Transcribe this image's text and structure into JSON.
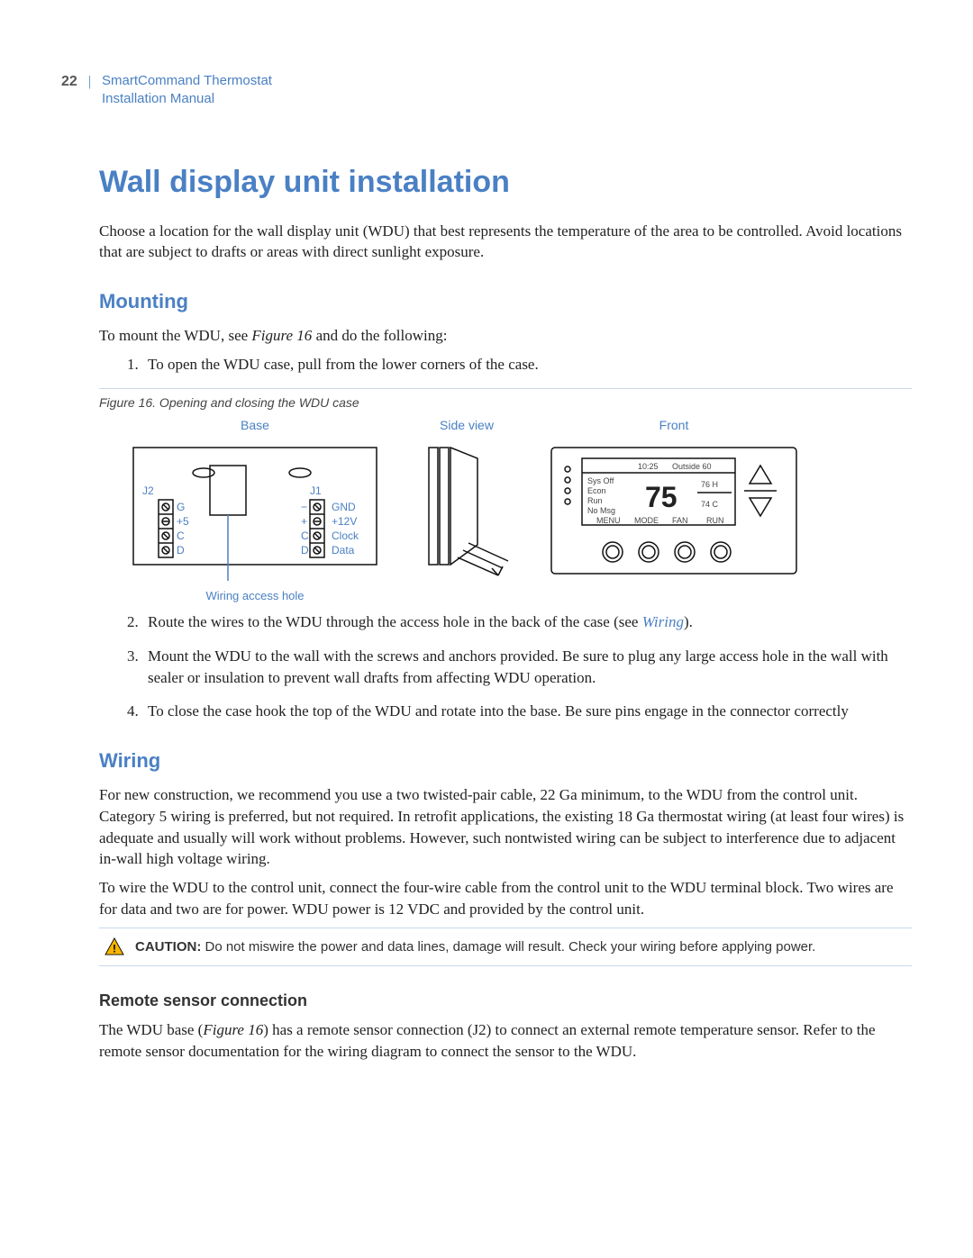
{
  "header": {
    "page_number": "22",
    "doc_title_line1": "SmartCommand Thermostat",
    "doc_title_line2": "Installation Manual"
  },
  "title": "Wall display unit installation",
  "intro": "Choose a location for the wall display unit (WDU) that best represents the temperature of the area to be controlled. Avoid locations that are subject to drafts or areas with direct sunlight exposure.",
  "mounting": {
    "heading": "Mounting",
    "lead_a": "To mount the WDU, see ",
    "lead_fig": "Figure 16",
    "lead_b": " and do the following:",
    "steps": {
      "s1": "To open the WDU case, pull from the lower corners of the case.",
      "s2_a": "Route the wires to the WDU through the access hole in the back of the case (see ",
      "s2_link": "Wiring",
      "s2_b": ").",
      "s3": "Mount the WDU to the wall with the screws and anchors provided. Be sure to plug any large access hole in the wall with sealer or insulation to prevent wall drafts from affecting WDU operation.",
      "s4": "To close the case hook the top of the WDU and rotate into the base. Be sure pins engage in the connector correctly"
    }
  },
  "figure": {
    "caption": "Figure 16. Opening and closing the WDU case",
    "labels": {
      "base": "Base",
      "side": "Side view",
      "front": "Front",
      "access": "Wiring access hole"
    },
    "base_diagram": {
      "j2": "J2",
      "j1": "J1",
      "j2_pins": [
        "G",
        "+5",
        "C",
        "D"
      ],
      "j1_pins": [
        "−",
        "+",
        "C",
        "D"
      ],
      "j1_names": [
        "GND",
        "+12V",
        "Clock",
        "Data"
      ]
    },
    "front_display": {
      "time": "10:25",
      "outside_label": "Outside 60",
      "left_lines": [
        "Sys Off",
        "Econ",
        "Run",
        "No Msg"
      ],
      "temp": "75",
      "right_lines": [
        "76 H",
        "74 C"
      ],
      "bottom_buttons": [
        "MENU",
        "MODE",
        "FAN",
        "RUN"
      ]
    }
  },
  "wiring": {
    "heading": "Wiring",
    "p1": "For new construction, we recommend you use a two twisted-pair cable, 22 Ga minimum, to the WDU from the control unit. Category 5 wiring is preferred, but not required. In retrofit applications, the existing 18 Ga thermostat wiring (at least four wires) is adequate and usually will work without problems. However, such nontwisted wiring can be subject to interference due to adjacent in-wall high voltage wiring.",
    "p2": "To wire the WDU to the control unit, connect the four-wire cable from the control unit to the WDU terminal block. Two wires are for data and two are for power. WDU power is 12 VDC and provided by the control unit.",
    "caution_label": "CAUTION:",
    "caution_text": " Do not miswire the power and data lines, damage will result. Check your wiring before applying power."
  },
  "remote": {
    "heading": "Remote sensor connection",
    "text_a": "The WDU base (",
    "text_fig": "Figure 16",
    "text_b": ") has a remote sensor connection (J2) to connect an external remote temperature sensor. Refer to the remote sensor documentation for the wiring diagram to connect the sensor to the WDU."
  }
}
